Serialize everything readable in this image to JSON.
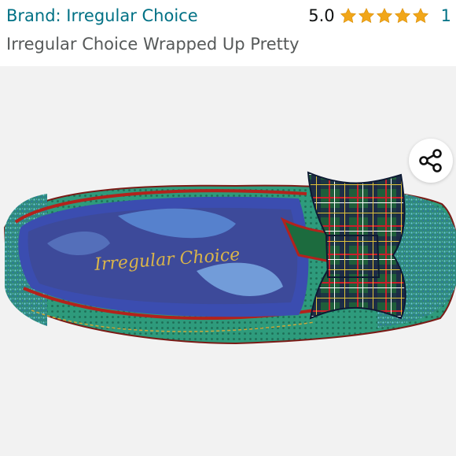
{
  "header": {
    "brand_label": "Brand: Irregular Choice",
    "rating_value": "5.0",
    "star_count": 5,
    "review_count": "1",
    "product_title": "Irregular Choice Wrapped Up Pretty"
  },
  "image": {
    "insole_text": "Irregular Choice",
    "alt": "product-photo"
  },
  "icons": {
    "share": "share-icon",
    "star": "star-icon"
  },
  "colors": {
    "link": "#007185",
    "star": "#f1a619",
    "title": "#565959"
  }
}
